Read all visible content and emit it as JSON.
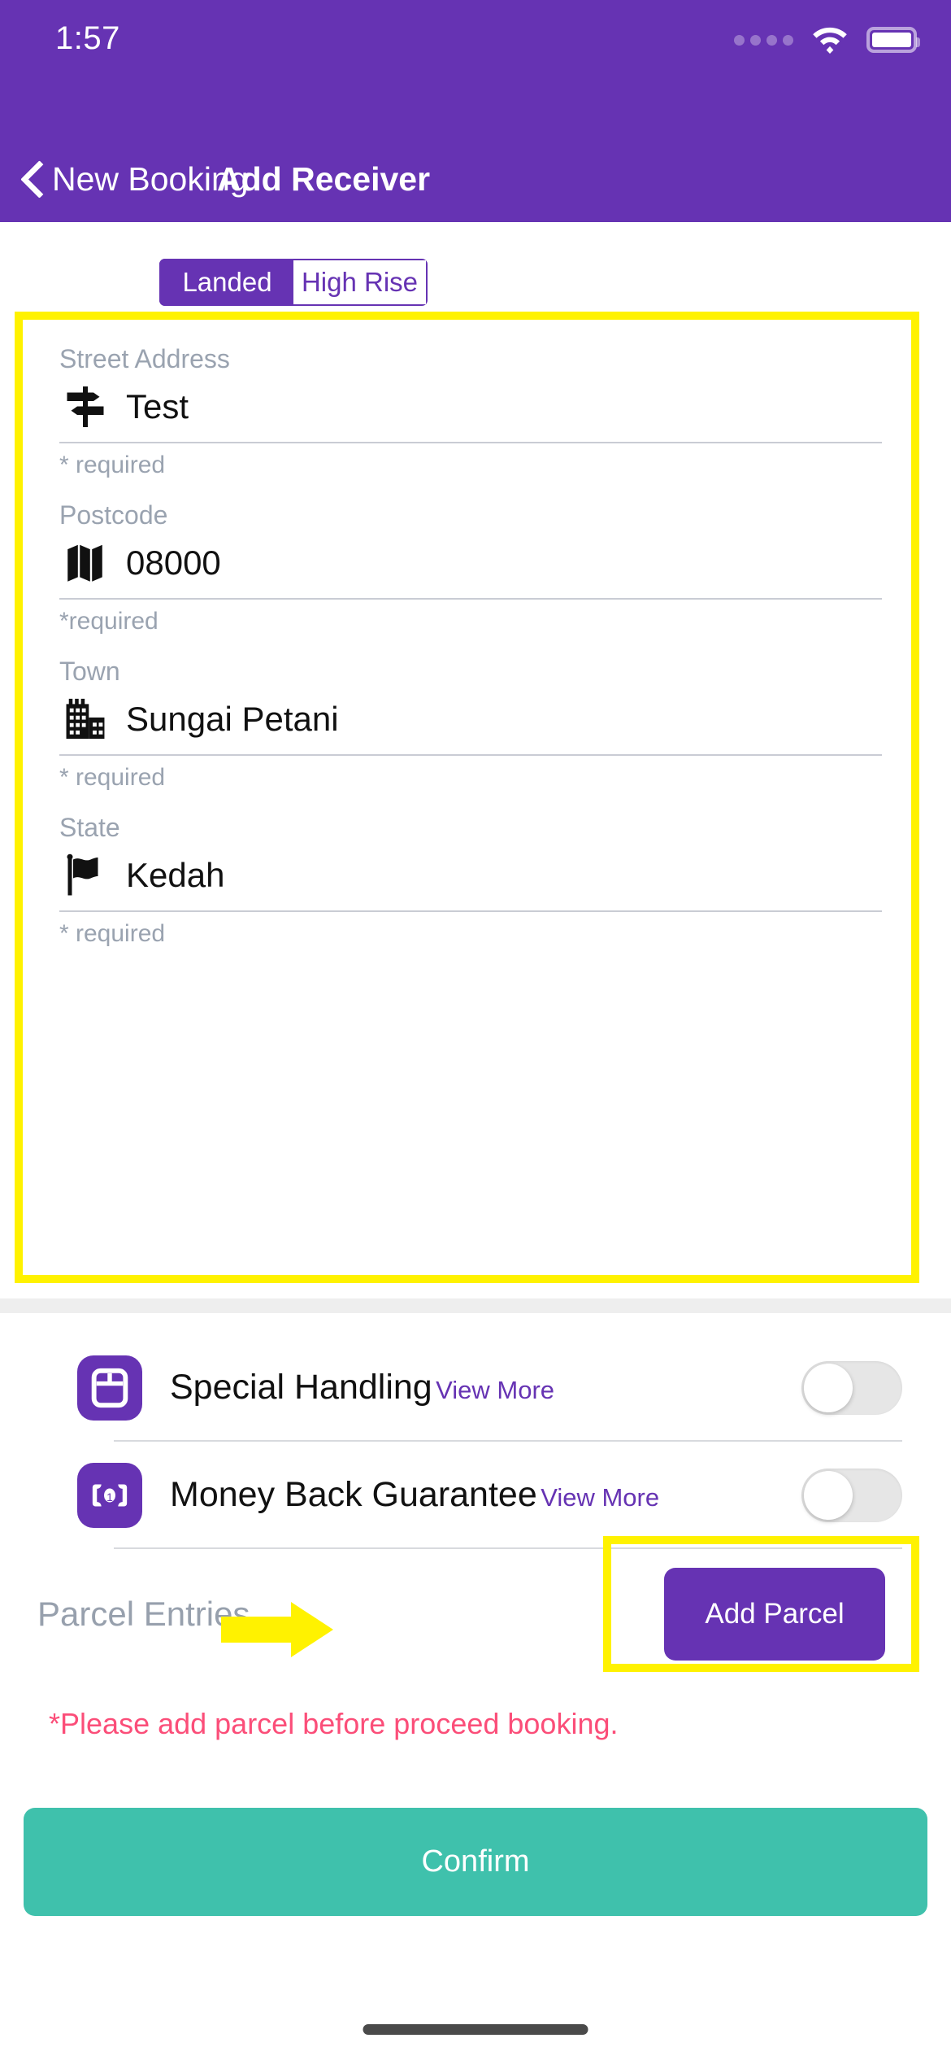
{
  "status_bar": {
    "time": "1:57",
    "signal_icon": "signal-dots-icon",
    "wifi_icon": "wifi-icon",
    "battery_icon": "battery-full-icon"
  },
  "nav": {
    "back_icon": "chevron-left-icon",
    "back_label": "New Booking",
    "title": "Add Receiver"
  },
  "segment": {
    "options": [
      {
        "label": "Landed",
        "selected": true
      },
      {
        "label": "High Rise",
        "selected": false
      }
    ]
  },
  "form": {
    "fields": [
      {
        "label": "Street Address",
        "icon": "signpost-icon",
        "value": "Test",
        "hint": "* required"
      },
      {
        "label": "Postcode",
        "icon": "folded-map-icon",
        "value": "08000",
        "hint": "*required"
      },
      {
        "label": "Town",
        "icon": "city-buildings-icon",
        "value": "Sungai Petani",
        "hint": "* required"
      },
      {
        "label": "State",
        "icon": "flag-icon",
        "value": "Kedah",
        "hint": "* required"
      }
    ]
  },
  "options": [
    {
      "title": "Special Handling",
      "link_label": "View More",
      "icon": "package-box-icon",
      "toggle_state": "off"
    },
    {
      "title": "Money Back Guarantee",
      "link_label": "View More",
      "icon": "banknote-icon",
      "toggle_state": "off"
    }
  ],
  "parcel": {
    "label": "Parcel Entries",
    "add_button": "Add Parcel",
    "error": "*Please add parcel before proceed booking.",
    "annotation_arrow_icon": "right-arrow-annotation-icon"
  },
  "confirm": {
    "label": "Confirm"
  },
  "colors": {
    "brand_purple": "#6633B3",
    "highlight_yellow": "#FFF200",
    "confirm_teal": "#3FC1AC",
    "error_pink": "#FB4E79",
    "label_grey": "#9AA3B0"
  }
}
